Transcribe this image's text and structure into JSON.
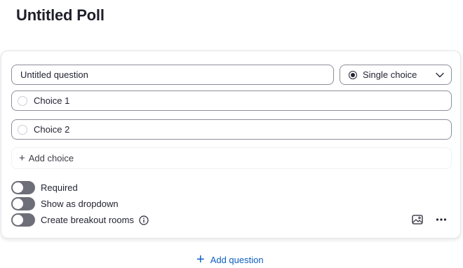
{
  "poll": {
    "title": "Untitled Poll"
  },
  "question": {
    "title": "Untitled question",
    "type_label": "Single choice",
    "type_icon": "radio-selected-icon",
    "choices": [
      {
        "label": "Choice 1"
      },
      {
        "label": "Choice 2"
      }
    ],
    "add_choice_label": "Add choice"
  },
  "options": {
    "required_label": "Required",
    "dropdown_label": "Show as dropdown",
    "breakout_label": "Create breakout rooms",
    "required_on": false,
    "dropdown_on": false,
    "breakout_on": false
  },
  "actions": {
    "add_question_label": "Add question",
    "image_icon": "image-icon",
    "more_icon": "more-horizontal-icon"
  },
  "colors": {
    "accent": "#0e5fc2",
    "toggle_off": "#6e6e78",
    "border": "#8e8e99"
  }
}
